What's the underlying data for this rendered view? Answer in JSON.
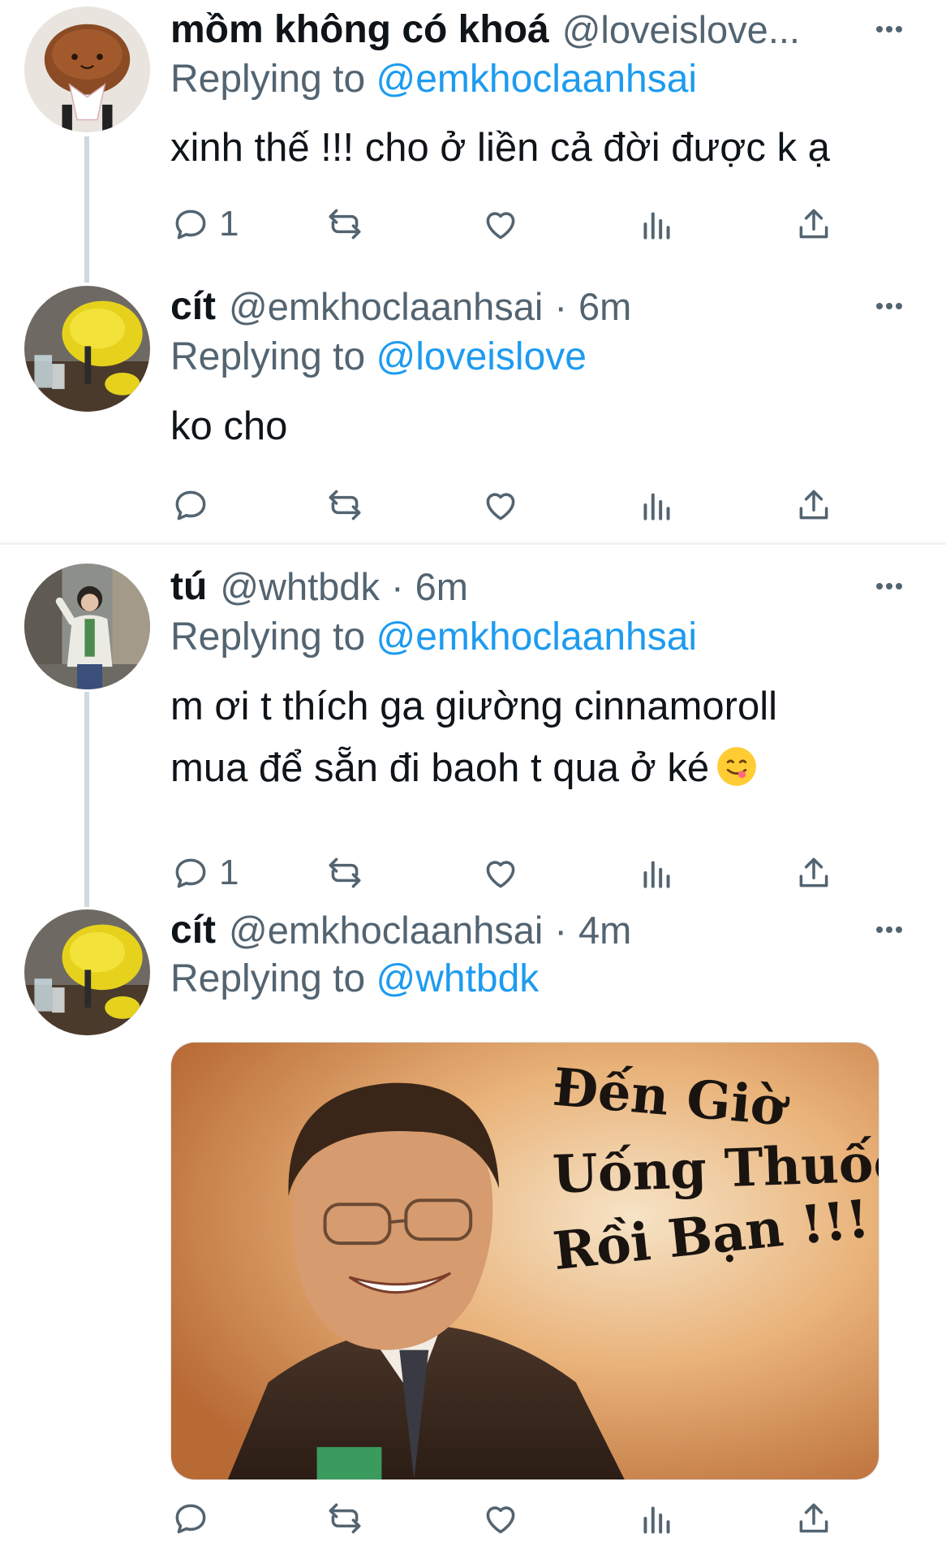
{
  "tweets": [
    {
      "name": "mồm không có khoá",
      "handle": "@loveislove...",
      "time": "",
      "replying_prefix": "Replying to",
      "replying_to": "@emkhoclaanhsai",
      "text_lines": [
        "xinh thế !!! cho ở liền cả đời được k ạ"
      ],
      "reply_count": "1",
      "avatar_icon": "bread-plush-avatar"
    },
    {
      "name": "cít",
      "handle": "@emkhoclaanhsai",
      "time": "6m",
      "replying_prefix": "Replying to",
      "replying_to": "@loveislove",
      "text_lines": [
        "ko cho"
      ],
      "reply_count": "",
      "avatar_icon": "yellow-plush-avatar"
    },
    {
      "name": "tú",
      "handle": "@whtbdk",
      "time": "6m",
      "replying_prefix": "Replying to",
      "replying_to": "@emkhoclaanhsai",
      "text_lines": [
        "m ơi t thích ga giường cinnamoroll",
        "mua để sẵn đi baoh t qua ở ké"
      ],
      "reply_count": "1",
      "avatar_icon": "person-street-avatar"
    },
    {
      "name": "cít",
      "handle": "@emkhoclaanhsai",
      "time": "4m",
      "replying_prefix": "Replying to",
      "replying_to": "@whtbdk",
      "text_lines": [],
      "reply_count": "",
      "avatar_icon": "yellow-plush-avatar",
      "media_caption": [
        "Đến Giờ",
        "Uống Thuốc",
        "Rồi Bạn !!!"
      ]
    }
  ],
  "time_separator": "·",
  "colors": {
    "link": "#1d9bf0",
    "secondary": "#536471",
    "text": "#0f1419"
  }
}
